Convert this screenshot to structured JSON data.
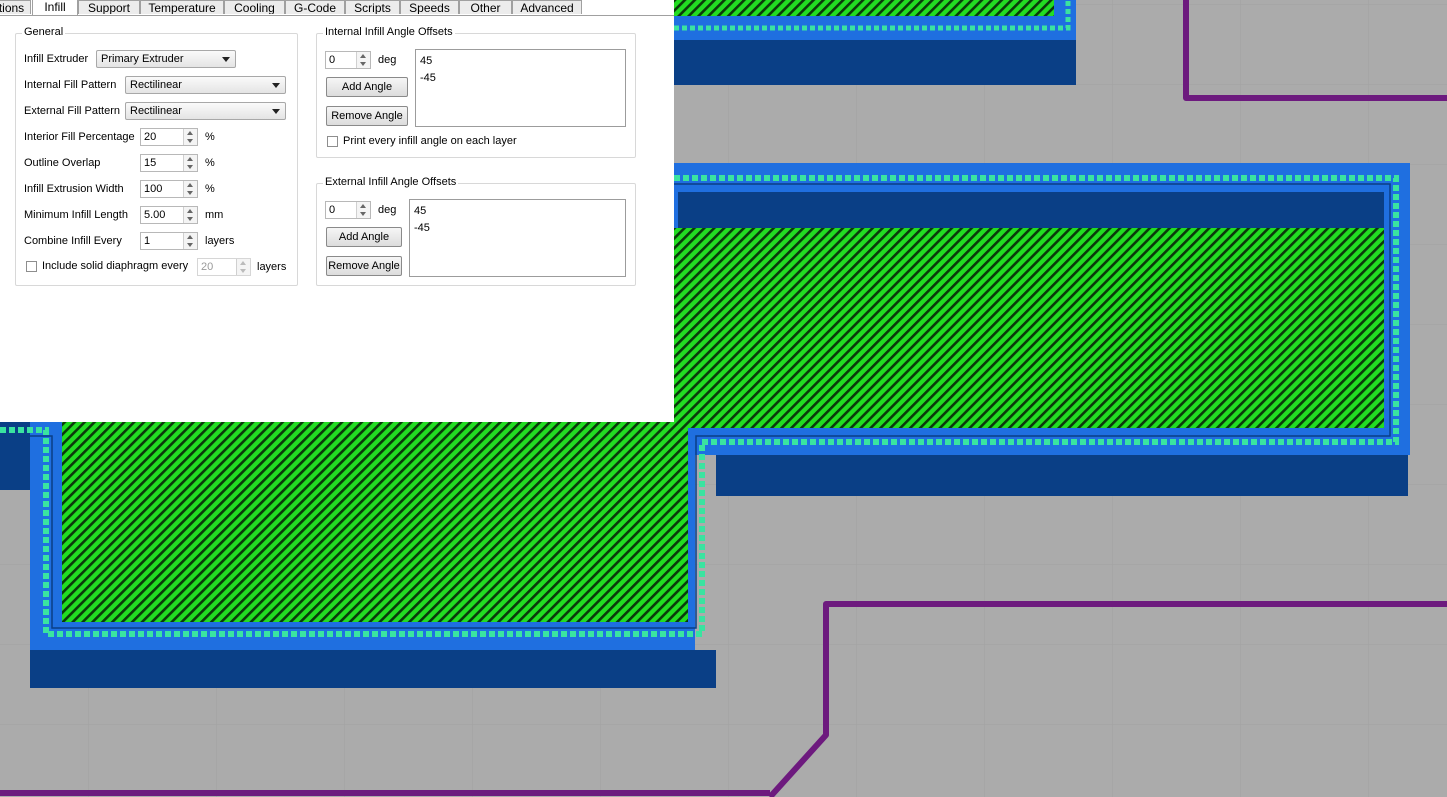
{
  "tabs": [
    "tions",
    "Infill",
    "Support",
    "Temperature",
    "Cooling",
    "G-Code",
    "Scripts",
    "Speeds",
    "Other",
    "Advanced"
  ],
  "active_tab": "Infill",
  "general": {
    "title": "General",
    "infill_extruder_label": "Infill Extruder",
    "infill_extruder_value": "Primary Extruder",
    "internal_fill_pattern_label": "Internal Fill Pattern",
    "internal_fill_pattern_value": "Rectilinear",
    "external_fill_pattern_label": "External Fill Pattern",
    "external_fill_pattern_value": "Rectilinear",
    "interior_fill_label": "Interior Fill Percentage",
    "interior_fill_value": "20",
    "interior_fill_unit": "%",
    "outline_overlap_label": "Outline Overlap",
    "outline_overlap_value": "15",
    "outline_overlap_unit": "%",
    "infill_width_label": "Infill Extrusion Width",
    "infill_width_value": "100",
    "infill_width_unit": "%",
    "min_length_label": "Minimum Infill Length",
    "min_length_value": "5.00",
    "min_length_unit": "mm",
    "combine_label": "Combine Infill Every",
    "combine_value": "1",
    "combine_unit": "layers",
    "diaphragm_label": "Include solid diaphragm every",
    "diaphragm_value": "20",
    "diaphragm_unit": "layers"
  },
  "internal_offsets": {
    "title": "Internal Infill Angle Offsets",
    "value": "0",
    "unit": "deg",
    "add_label": "Add Angle",
    "remove_label": "Remove Angle",
    "angles": [
      "45",
      "-45"
    ],
    "print_every_label": "Print every infill angle on each layer"
  },
  "external_offsets": {
    "title": "External Infill Angle Offsets",
    "value": "0",
    "unit": "deg",
    "add_label": "Add Angle",
    "remove_label": "Remove Angle",
    "angles": [
      "45",
      "-45"
    ]
  },
  "colors": {
    "viewport_bg": "#ababab",
    "wall_blue": "#1f6fe0",
    "wall_dark": "#0a3f86",
    "infill_green": "#22dd22",
    "outline_teal": "#3ae3a0",
    "travel_purple": "#6d1a7e"
  }
}
